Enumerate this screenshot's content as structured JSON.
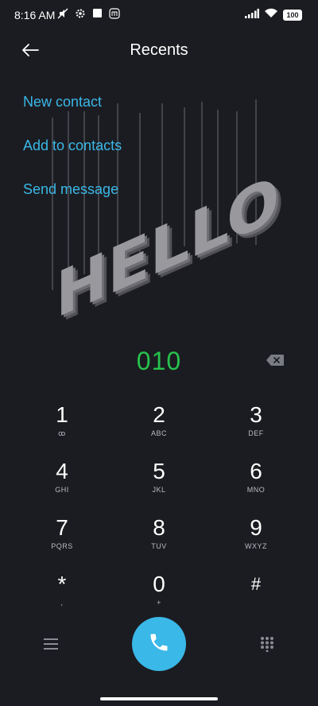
{
  "status_bar": {
    "time": "8:16 AM",
    "battery": "100",
    "icons": [
      "mute-icon",
      "settings-icon",
      "square-icon",
      "mi-icon",
      "signal-icon",
      "wifi-icon",
      "battery-icon"
    ]
  },
  "header": {
    "title": "Recents",
    "back_icon": "back-arrow-icon"
  },
  "actions": {
    "new_contact": "New contact",
    "add_to_contacts": "Add to contacts",
    "send_message": "Send message"
  },
  "artwork": {
    "text": "HELLO"
  },
  "dialer": {
    "number": "010",
    "backspace_icon": "backspace-icon"
  },
  "keypad": {
    "keys": [
      {
        "digit": "1",
        "letters": "ꝏ"
      },
      {
        "digit": "2",
        "letters": "ABC"
      },
      {
        "digit": "3",
        "letters": "DEF"
      },
      {
        "digit": "4",
        "letters": "GHI"
      },
      {
        "digit": "5",
        "letters": "JKL"
      },
      {
        "digit": "6",
        "letters": "MNO"
      },
      {
        "digit": "7",
        "letters": "PQRS"
      },
      {
        "digit": "8",
        "letters": "TUV"
      },
      {
        "digit": "9",
        "letters": "WXYZ"
      },
      {
        "digit": "*",
        "letters": ","
      },
      {
        "digit": "0",
        "letters": "+"
      },
      {
        "digit": "#",
        "letters": ""
      }
    ]
  },
  "bottom_bar": {
    "menu_icon": "menu-icon",
    "call_icon": "phone-icon",
    "dialpad_icon": "dialpad-icon"
  },
  "colors": {
    "background": "#1b1c21",
    "accent": "#3ab8e8",
    "number": "#27c24c"
  }
}
